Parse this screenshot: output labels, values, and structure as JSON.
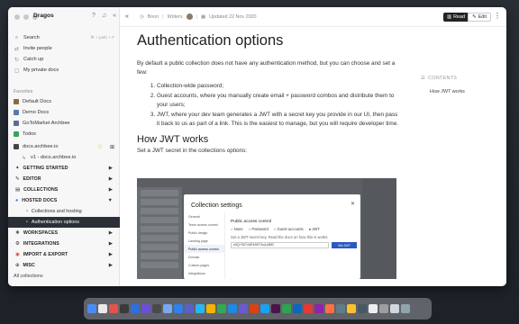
{
  "sidebar": {
    "workspace": "Dragos",
    "nav": [
      {
        "label": "Search",
        "hint": "⌘ + path + F",
        "icon": "search-icon"
      },
      {
        "label": "Invite people",
        "icon": "invite-icon"
      },
      {
        "label": "Catch up",
        "icon": "catch-up-icon"
      },
      {
        "label": "My private docs",
        "icon": "lock-icon"
      }
    ],
    "favorites_label": "Favorites",
    "favorites": [
      {
        "label": "Default Docs",
        "color": "#8a6a44"
      },
      {
        "label": "Demo Docs",
        "color": "#5a7ba8"
      },
      {
        "label": "GoToMarket Archbee",
        "color": "#5b6e8f"
      },
      {
        "label": "Todos",
        "color": "#3aa35b"
      }
    ],
    "site": "docs.archbee.io",
    "version": "v1 - docs.archbee.io",
    "tree": [
      {
        "label": "GETTING STARTED",
        "icon": "rocket-icon"
      },
      {
        "label": "EDITOR",
        "icon": "pencil-icon"
      },
      {
        "label": "COLLECTIONS",
        "icon": "collections-icon"
      },
      {
        "label": "HOSTED DOCS",
        "icon": "globe-icon"
      }
    ],
    "hosted_children": [
      {
        "label": "Collections and hosting",
        "active": false
      },
      {
        "label": "Authentication options",
        "active": true
      }
    ],
    "tree2": [
      {
        "label": "WORKSPACES",
        "icon": "workspaces-icon"
      },
      {
        "label": "INTEGRATIONS",
        "icon": "integrations-icon"
      },
      {
        "label": "IMPORT & EXPORT",
        "icon": "import-export-icon"
      },
      {
        "label": "MISC",
        "icon": "misc-icon"
      }
    ],
    "all_collections": "All collections"
  },
  "topbar": {
    "crumb1": "Bnon",
    "crumb2": "Writers",
    "updated": "Updated 22 Nov 2020",
    "read": "Read",
    "edit": "Edit"
  },
  "doc": {
    "title": "Authentication options",
    "intro": "By default a public collection does not have any authentication method, but you can choose and set a few:",
    "list": [
      "Collection-wide password;",
      "Guest accounts, where you manually create email + password combos and distribute them to your users;",
      "JWT, where your dev team generates a JWT with a secret key you provide in our UI, then pass it back to us as part of a link. This is the easiest to manage, but you will require developer time."
    ],
    "h2": "How JWT works",
    "jwt_intro": "Set a JWT secret in the collections options:"
  },
  "embedded": {
    "modal_title": "Collection settings",
    "menu": [
      "General",
      "Team access control",
      "Public design",
      "Landing page",
      "Public access control",
      "Domain",
      "Custom pages",
      "Integrations"
    ],
    "heading": "Public access control",
    "options": [
      "None",
      "Password",
      "Guest accounts",
      "JWT"
    ],
    "selected": "JWT",
    "sub": "Set a JWT secret key. Read the docs on how this is works.",
    "key": "eGQ+SD7x9RkS0T4q1pB0C",
    "button": "Set JWT"
  },
  "toc": {
    "title": "CONTENTS",
    "items": [
      "How JWT works"
    ]
  },
  "dock_colors": [
    "#4a8cf7",
    "#e9e9ea",
    "#e4534a",
    "#3b3b3b",
    "#2d6ee0",
    "#6b4fd8",
    "#4a4a4a",
    "#7aa7f2",
    "#2f80ed",
    "#5b5fc7",
    "#29b6f6",
    "#f4b400",
    "#34a853",
    "#1e88e5",
    "#6a5acd",
    "#d84315",
    "#1da1f2",
    "#4a154b",
    "#2ea44f",
    "#0a66c2",
    "#e53935",
    "#8e24aa",
    "#ff7043",
    "#607d8b",
    "#fbc02d",
    "#455a64",
    "#eeeeee",
    "#9e9e9e",
    "#cfd8dc",
    "#90a4ae"
  ]
}
